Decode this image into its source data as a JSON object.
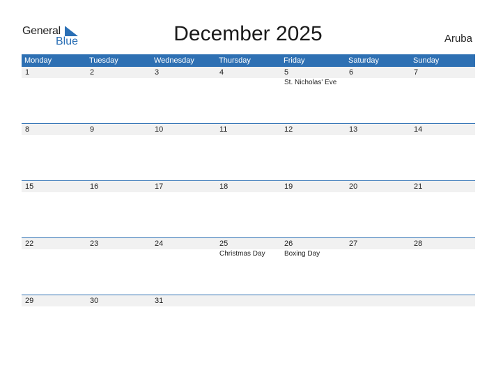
{
  "logo": {
    "line1": "General",
    "line2": "Blue"
  },
  "title": "December 2025",
  "country": "Aruba",
  "days": [
    "Monday",
    "Tuesday",
    "Wednesday",
    "Thursday",
    "Friday",
    "Saturday",
    "Sunday"
  ],
  "weeks": [
    {
      "dates": [
        "1",
        "2",
        "3",
        "4",
        "5",
        "6",
        "7"
      ],
      "holidays": [
        "",
        "",
        "",
        "",
        "St. Nicholas' Eve",
        "",
        ""
      ]
    },
    {
      "dates": [
        "8",
        "9",
        "10",
        "11",
        "12",
        "13",
        "14"
      ],
      "holidays": [
        "",
        "",
        "",
        "",
        "",
        "",
        ""
      ]
    },
    {
      "dates": [
        "15",
        "16",
        "17",
        "18",
        "19",
        "20",
        "21"
      ],
      "holidays": [
        "",
        "",
        "",
        "",
        "",
        "",
        ""
      ]
    },
    {
      "dates": [
        "22",
        "23",
        "24",
        "25",
        "26",
        "27",
        "28"
      ],
      "holidays": [
        "",
        "",
        "",
        "Christmas Day",
        "Boxing Day",
        "",
        ""
      ]
    },
    {
      "dates": [
        "29",
        "30",
        "31",
        "",
        "",
        "",
        ""
      ],
      "holidays": [
        "",
        "",
        "",
        "",
        "",
        "",
        ""
      ]
    }
  ]
}
